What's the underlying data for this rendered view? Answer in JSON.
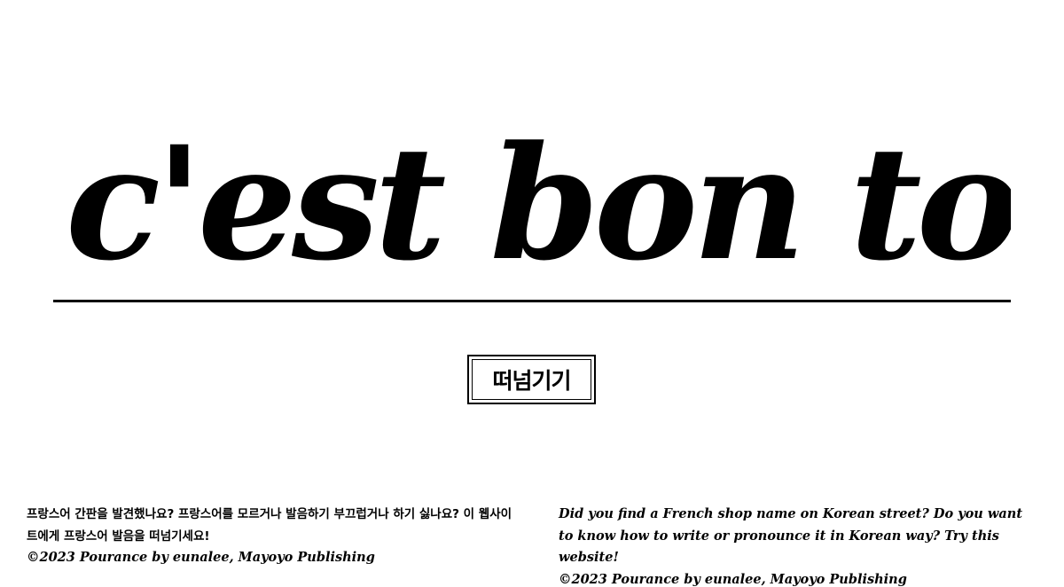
{
  "app": {
    "title": "Pourance"
  },
  "hero": {
    "input_value": "c'est bon to",
    "placeholder": ""
  },
  "submit": {
    "label": "떠넘기기"
  },
  "footer": {
    "korean": {
      "description": "프랑스어 간판을 발견했나요? 프랑스어를 모르거나 발음하기 부끄럽거나 하기 싫나요? 이 웹사이트에게 프랑스어 발음을 떠넘기세요!",
      "copyright": "©2023 Pourance by eunalee, Mayoyo Publishing"
    },
    "english": {
      "description": "Did you find a French shop name on Korean street? Do you want to know how to write or pronounce it in Korean way? Try this website!",
      "copyright": "©2023 Pourance by eunalee, Mayoyo Publishing"
    }
  },
  "colors": {
    "background": "#ffffff",
    "text": "#000000",
    "accent": "#000000"
  }
}
